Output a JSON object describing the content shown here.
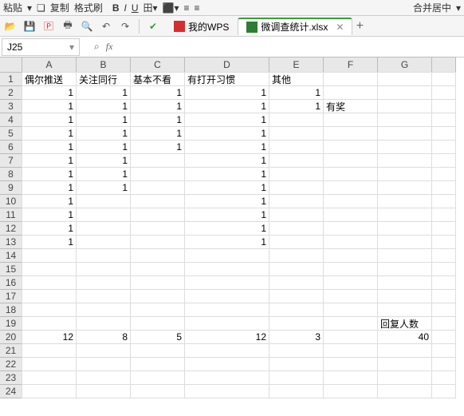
{
  "toolbar_top": {
    "paste": "粘贴",
    "copy": "复制",
    "format": "格式刷",
    "merge": "合并居中"
  },
  "tabs": {
    "wps": "我的WPS",
    "file": "微调查统计.xlsx"
  },
  "namebox": "J25",
  "columns": [
    "A",
    "B",
    "C",
    "D",
    "E",
    "F",
    "G"
  ],
  "rows": [
    1,
    2,
    3,
    4,
    5,
    6,
    7,
    8,
    9,
    10,
    11,
    12,
    13,
    14,
    15,
    16,
    17,
    18,
    19,
    20,
    21,
    22,
    23,
    24
  ],
  "cells": {
    "A1": "偶尔推送",
    "B1": "关注同行",
    "C1": "基本不看",
    "D1": "有打开习惯",
    "E1": "其他",
    "A2": "1",
    "B2": "1",
    "C2": "1",
    "D2": "1",
    "E2": "1",
    "A3": "1",
    "B3": "1",
    "C3": "1",
    "D3": "1",
    "E3": "1",
    "F3": "有奖",
    "A4": "1",
    "B4": "1",
    "C4": "1",
    "D4": "1",
    "A5": "1",
    "B5": "1",
    "C5": "1",
    "D5": "1",
    "A6": "1",
    "B6": "1",
    "C6": "1",
    "D6": "1",
    "A7": "1",
    "B7": "1",
    "D7": "1",
    "A8": "1",
    "B8": "1",
    "D8": "1",
    "A9": "1",
    "B9": "1",
    "D9": "1",
    "A10": "1",
    "D10": "1",
    "A11": "1",
    "D11": "1",
    "A12": "1",
    "D12": "1",
    "A13": "1",
    "D13": "1",
    "G19": "回复人数",
    "A20": "12",
    "B20": "8",
    "C20": "5",
    "D20": "12",
    "E20": "3",
    "G20": "40"
  },
  "chart_data": {
    "type": "table",
    "title": "微调查统计",
    "headers": [
      "偶尔推送",
      "关注同行",
      "基本不看",
      "有打开习惯",
      "其他"
    ],
    "rows": [
      [
        1,
        1,
        1,
        1,
        1
      ],
      [
        1,
        1,
        1,
        1,
        1
      ],
      [
        1,
        1,
        1,
        1,
        null
      ],
      [
        1,
        1,
        1,
        1,
        null
      ],
      [
        1,
        1,
        1,
        1,
        null
      ],
      [
        1,
        1,
        null,
        1,
        null
      ],
      [
        1,
        1,
        null,
        1,
        null
      ],
      [
        1,
        1,
        null,
        1,
        null
      ],
      [
        1,
        null,
        null,
        1,
        null
      ],
      [
        1,
        null,
        null,
        1,
        null
      ],
      [
        1,
        null,
        null,
        1,
        null
      ],
      [
        1,
        null,
        null,
        1,
        null
      ]
    ],
    "totals": {
      "偶尔推送": 12,
      "关注同行": 8,
      "基本不看": 5,
      "有打开习惯": 12,
      "其他": 3,
      "回复人数": 40
    }
  }
}
